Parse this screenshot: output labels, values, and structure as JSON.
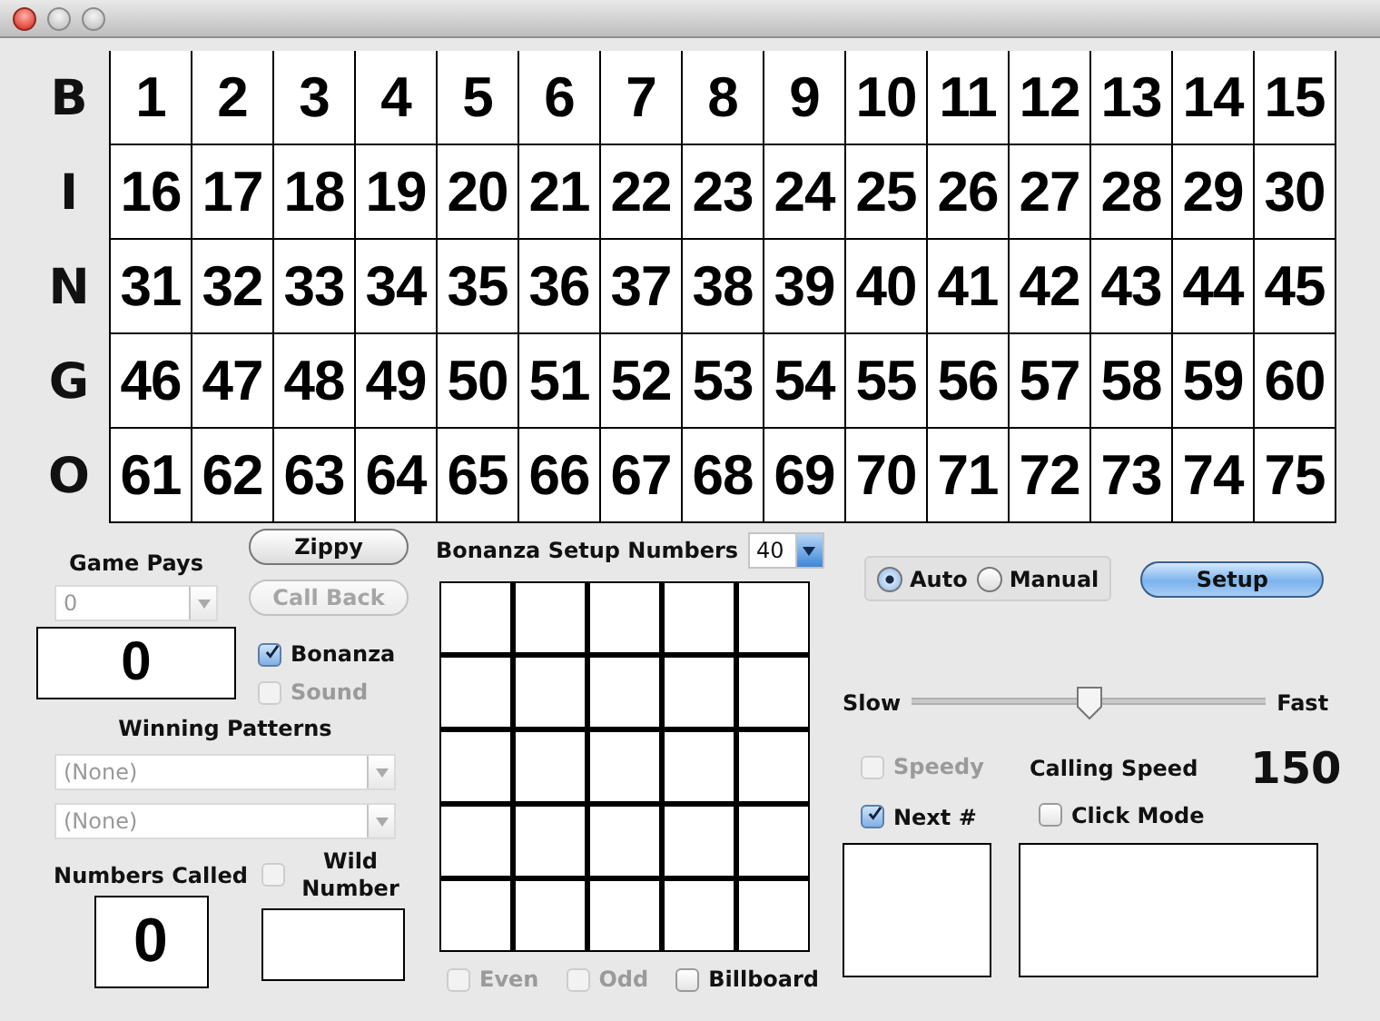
{
  "board": {
    "rows": [
      {
        "letter": "B",
        "numbers": [
          "1",
          "2",
          "3",
          "4",
          "5",
          "6",
          "7",
          "8",
          "9",
          "10",
          "11",
          "12",
          "13",
          "14",
          "15"
        ]
      },
      {
        "letter": "I",
        "numbers": [
          "16",
          "17",
          "18",
          "19",
          "20",
          "21",
          "22",
          "23",
          "24",
          "25",
          "26",
          "27",
          "28",
          "29",
          "30"
        ]
      },
      {
        "letter": "N",
        "numbers": [
          "31",
          "32",
          "33",
          "34",
          "35",
          "36",
          "37",
          "38",
          "39",
          "40",
          "41",
          "42",
          "43",
          "44",
          "45"
        ]
      },
      {
        "letter": "G",
        "numbers": [
          "46",
          "47",
          "48",
          "49",
          "50",
          "51",
          "52",
          "53",
          "54",
          "55",
          "56",
          "57",
          "58",
          "59",
          "60"
        ]
      },
      {
        "letter": "O",
        "numbers": [
          "61",
          "62",
          "63",
          "64",
          "65",
          "66",
          "67",
          "68",
          "69",
          "70",
          "71",
          "72",
          "73",
          "74",
          "75"
        ]
      }
    ]
  },
  "game_pays": {
    "label": "Game Pays",
    "popup": {
      "value": "0",
      "disabled": true
    },
    "display": "0"
  },
  "buttons": [
    {
      "label": "Zippy",
      "disabled": false
    },
    {
      "label": "Call Back",
      "disabled": true
    }
  ],
  "options": [
    {
      "label": "Bonanza",
      "checked": true,
      "disabled": false
    },
    {
      "label": "Sound",
      "checked": false,
      "disabled": true
    }
  ],
  "winning_patterns": {
    "label": "Winning Patterns",
    "popups": [
      {
        "value": "(None)",
        "disabled": true
      },
      {
        "value": "(None)",
        "disabled": true
      }
    ]
  },
  "numbers_called": {
    "label": "Numbers Called",
    "display": "0"
  },
  "wild_number": {
    "label": "Wild Number",
    "checked": false,
    "disabled": true
  },
  "bonanza": {
    "label": "Bonanza Setup Numbers",
    "popup": {
      "value": "40",
      "disabled": false
    },
    "filters": [
      {
        "label": "Even",
        "checked": false,
        "disabled": true
      },
      {
        "label": "Odd",
        "checked": false,
        "disabled": true
      },
      {
        "label": "Billboard",
        "checked": false,
        "disabled": false
      }
    ]
  },
  "mode": [
    {
      "label": "Auto",
      "selected": true
    },
    {
      "label": "Manual",
      "selected": false
    }
  ],
  "setup_button": {
    "label": "Setup"
  },
  "speed": {
    "min_label": "Slow",
    "max_label": "Fast",
    "level": 0.5,
    "speedy": {
      "label": "Speedy",
      "checked": false,
      "disabled": true
    },
    "label": "Calling Speed",
    "reading": "150"
  },
  "next_number": {
    "label": "Next #",
    "checked": true,
    "disabled": false
  },
  "click_mode": {
    "label": "Click Mode",
    "checked": false,
    "disabled": false
  }
}
